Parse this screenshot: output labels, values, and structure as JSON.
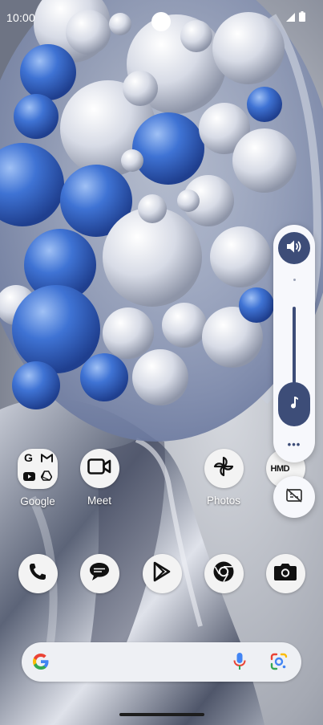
{
  "status_bar": {
    "time": "10:00",
    "icons": [
      "signal-icon",
      "battery-icon"
    ]
  },
  "home_screen": {
    "row1": [
      {
        "name": "Google",
        "type": "folder",
        "contents": [
          "google-icon",
          "gmail-icon",
          "youtube-icon",
          "drive-icon"
        ]
      },
      {
        "name": "Meet",
        "icon": "video-camera-icon"
      },
      {
        "name": "",
        "icon": "empty"
      },
      {
        "name": "Photos",
        "icon": "pinwheel-icon"
      },
      {
        "name": "",
        "icon": "hmd-widget-icon",
        "text": "HMD"
      }
    ],
    "dock": [
      {
        "icon": "phone-icon"
      },
      {
        "icon": "messages-icon"
      },
      {
        "icon": "play-store-icon"
      },
      {
        "icon": "chrome-icon"
      },
      {
        "icon": "camera-icon"
      }
    ]
  },
  "volume_panel": {
    "ringer_icon": "speaker-icon",
    "media_icon": "music-note-icon",
    "more": "•••",
    "level": 0.27,
    "live_caption_icon": "captions-off-icon"
  },
  "search": {
    "logo": "google-g-icon",
    "mic": "mic-icon",
    "lens": "lens-icon"
  },
  "colors": {
    "accent": "#3d4d78",
    "panel": "#f7f8fc"
  }
}
